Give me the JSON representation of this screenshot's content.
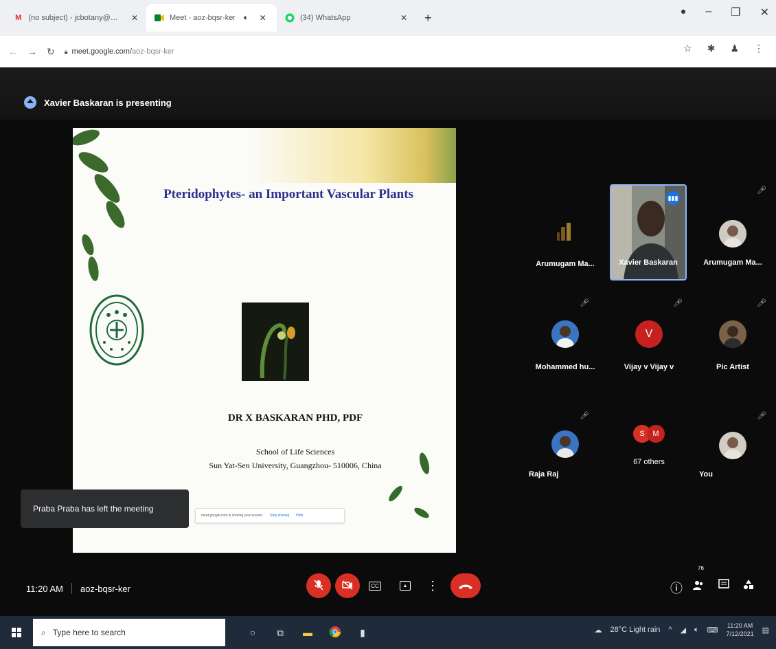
{
  "browser": {
    "tabs": [
      {
        "icon": "gmail-icon",
        "label": "(no subject) - jcbotany@gmai...",
        "active": false
      },
      {
        "icon": "meet-icon",
        "label": "Meet - aoz-bqsr-ker",
        "active": true
      },
      {
        "icon": "whatsapp-icon",
        "label": "(34) WhatsApp",
        "active": false
      }
    ],
    "url_host": "meet.google.com/",
    "url_path": "aoz-bqsr-ker"
  },
  "meet": {
    "presenting_text": "Xavier Baskaran is presenting",
    "slide": {
      "title": "Pteridophytes- an Important Vascular Plants",
      "author": "DR X BASKARAN PHD, PDF",
      "school": "School of Life Sciences",
      "university": "Sun Yat-Sen University, Guangzhou- 510006, China",
      "logo_text": "SUN YAT-SEN UNIVERSITY",
      "share_bar": {
        "text": "meet.google.com is sharing your screen.",
        "stop": "Stop sharing",
        "hide": "Hide"
      }
    },
    "toast": "Praba Praba has left the meeting",
    "participants": [
      {
        "name": "Arumugam Ma...",
        "kind": "photo"
      },
      {
        "name": "Xavier Baskaran",
        "kind": "speaker"
      },
      {
        "name": "Arumugam Ma...",
        "kind": "photo"
      },
      {
        "name": "Mohammed hu...",
        "kind": "photo"
      },
      {
        "name": "Vijay v Vijay v",
        "kind": "initial",
        "initial": "V",
        "color": "#c5221f"
      },
      {
        "name": "Pic Artist",
        "kind": "photo"
      },
      {
        "name": "Raja Raj",
        "kind": "photo"
      },
      {
        "name": "67 others",
        "kind": "group",
        "initials": [
          "S",
          "M"
        ]
      },
      {
        "name": "You",
        "kind": "photo"
      }
    ],
    "time": "11:20 AM",
    "meeting_code": "aoz-bqsr-ker",
    "participant_count": "76"
  },
  "taskbar": {
    "search_placeholder": "Type here to search",
    "weather": "28°C  Light rain",
    "time": "11:20 AM",
    "date": "7/12/2021"
  },
  "colors": {
    "accent_red": "#d93025",
    "meet_bg": "#0b0b0c",
    "slide_title": "#2b2f8f",
    "speaker_border": "#8ab4f8"
  }
}
